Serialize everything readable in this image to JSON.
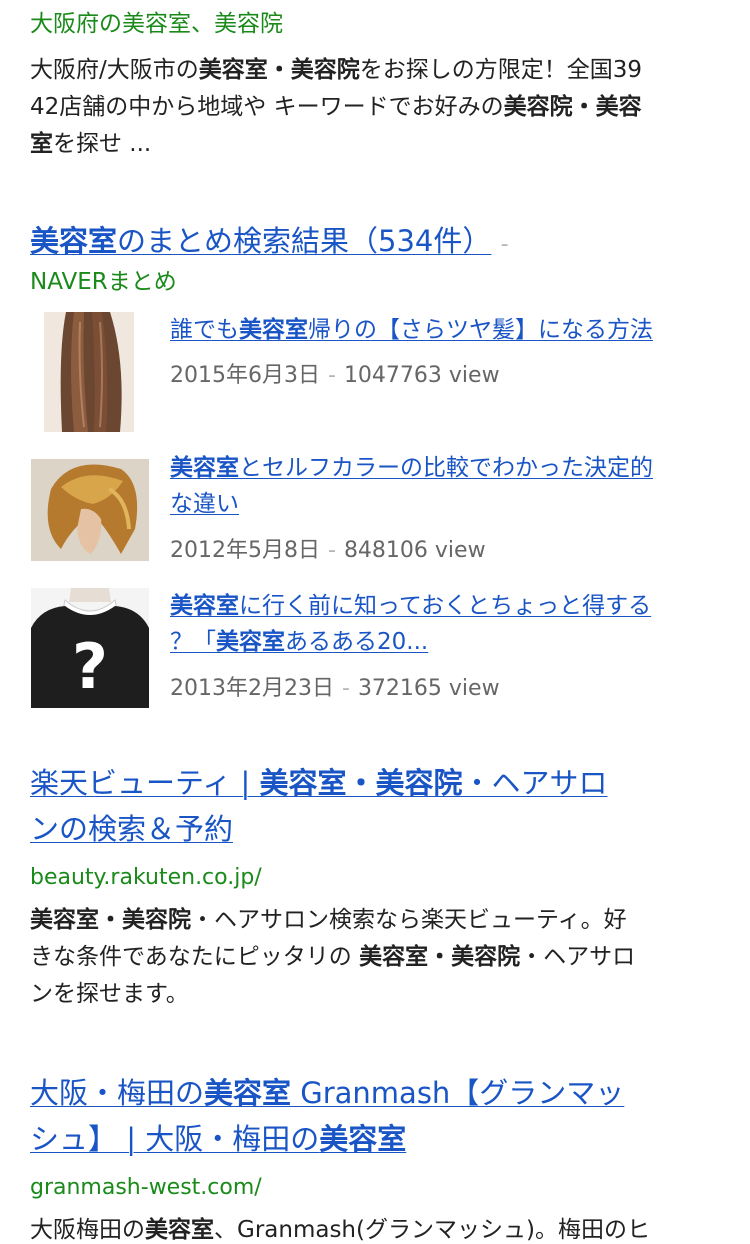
{
  "result1": {
    "url_line": "大阪府の美容室、美容院",
    "snippet": [
      {
        "t": "大阪府/大阪市の",
        "b": false
      },
      {
        "t": "美容室・美容院",
        "b": true
      },
      {
        "t": "をお探しの方限定！全国39",
        "b": false
      },
      {
        "t": "42店舗の中から地域や キーワードでお好みの",
        "b": false
      },
      {
        "t": "美容院・美容",
        "b": true
      },
      {
        "t": "室",
        "b": true
      },
      {
        "t": "を探せ ...",
        "b": false
      }
    ]
  },
  "result2": {
    "title_pre": "美容室",
    "title_post": "のまとめ検索結果（534件）",
    "source": "NAVERまとめ",
    "items": [
      {
        "title_pre": "誰でも",
        "title_bold": "美容室",
        "title_post": "帰りの【さらツヤ髪】になる方法",
        "date": "2015年6月3日",
        "views": "1047763 view",
        "thumb_icon": "long-hair-thumbnail"
      },
      {
        "title_line1_bold": "美容室",
        "title_line1": "とセルフカラーの比較でわかった決定的",
        "title_line2": "な違い",
        "date": "2012年5月8日",
        "views": "848106 view",
        "thumb_icon": "blonde-bob-thumbnail"
      },
      {
        "title_line1_bold": "美容室",
        "title_line1": "に行く前に知っておくとちょっと得する",
        "title_line2_pre": "？「",
        "title_line2_bold": "美容室",
        "title_line2_post": "あるある20...",
        "date": "2013年2月23日",
        "views": "372165 view",
        "thumb_icon": "question-mark-sweater-thumbnail"
      }
    ]
  },
  "result3": {
    "title_line1_pre": "楽天ビューティ | ",
    "title_line1_bold": "美容室・美容院",
    "title_line1_post": "・ヘアサロ",
    "title_line2": "ンの検索＆予約",
    "url": "beauty.rakuten.co.jp/",
    "snippet_line1_bold": "美容室・美容院",
    "snippet_line1": "・ヘアサロン検索なら楽天ビューティ。好",
    "snippet_line2_pre": "きな条件であなたにピッタリの ",
    "snippet_line2_bold": "美容室・美容院",
    "snippet_line2_post": "・ヘアサロ",
    "snippet_line3": "ンを探せます。"
  },
  "result4": {
    "title_line1_pre": "大阪・梅田の",
    "title_line1_bold": "美容室",
    "title_line1_post": " Granmash【グランマッ",
    "title_line2_pre": "シュ】 | 大阪・梅田の",
    "title_line2_bold": "美容室",
    "url": "granmash-west.com/",
    "snippet_pre": "大阪梅田の",
    "snippet_bold": "美容室",
    "snippet_post": "、Granmash(グランマッシュ)。梅田のヒ"
  },
  "separator": "-",
  "colors": {
    "link": "#1a55c6",
    "url_green": "#1a8a1a",
    "meta_gray": "#666666",
    "text": "#222222"
  }
}
